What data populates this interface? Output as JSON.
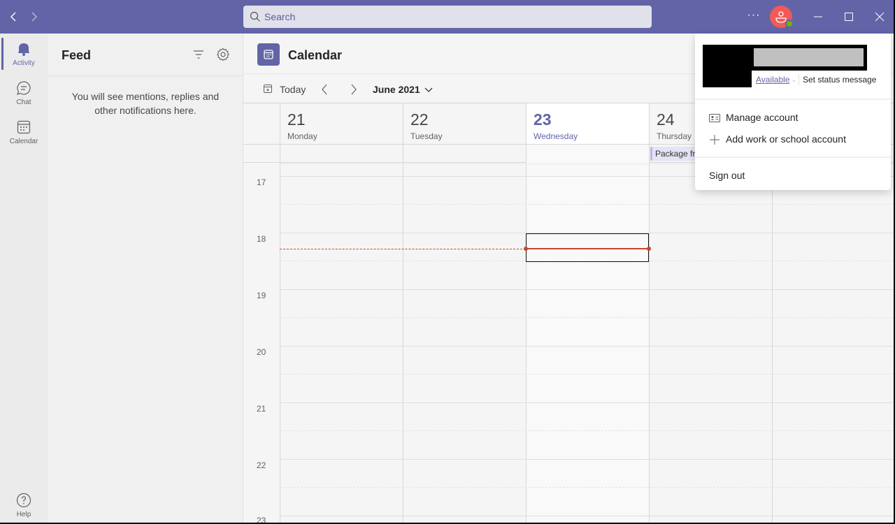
{
  "titlebar": {
    "search_placeholder": "Search",
    "more_label": "···",
    "colors": {
      "brand": "#6264a7",
      "avatar": "#f05a58",
      "presence": "#6bb700"
    }
  },
  "rail": {
    "items": [
      {
        "label": "Activity",
        "icon": "bell-icon",
        "active": true
      },
      {
        "label": "Chat",
        "icon": "chat-icon",
        "active": false
      },
      {
        "label": "Calendar",
        "icon": "calendar-icon",
        "active": false
      }
    ],
    "help_label": "Help"
  },
  "feed": {
    "title": "Feed",
    "empty_message": "You will see mentions, replies and other notifications here."
  },
  "calendar": {
    "title": "Calendar",
    "today_label": "Today",
    "month_label": "June 2021",
    "days": [
      {
        "num": "21",
        "name": "Monday",
        "today": false
      },
      {
        "num": "22",
        "name": "Tuesday",
        "today": false
      },
      {
        "num": "23",
        "name": "Wednesday",
        "today": true
      },
      {
        "num": "24",
        "name": "Thursday",
        "today": false
      }
    ],
    "all_day_event": "Package fr",
    "hours": [
      "17",
      "18",
      "19",
      "20",
      "21",
      "22",
      "23"
    ],
    "current_time_color": "#c4462d"
  },
  "profile_menu": {
    "status": "Available",
    "set_status": "Set status message",
    "manage_account": "Manage account",
    "add_account": "Add work or school account",
    "sign_out": "Sign out"
  }
}
